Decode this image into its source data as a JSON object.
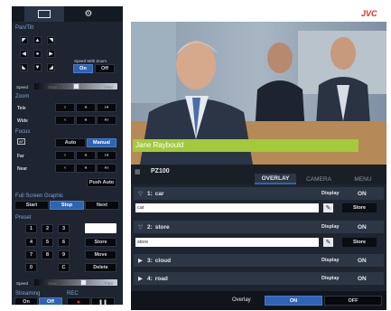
{
  "left": {
    "tabs": [
      {
        "icon": "monitor-icon"
      },
      {
        "icon": "gear-icon"
      }
    ],
    "pan_tilt": {
      "title": "Pan/Tilt",
      "speed_with_zoom_label": "Speed With Zoom",
      "on": "On",
      "off": "Off",
      "speed_label": "Speed",
      "slow": "Slow",
      "fast": "Fast",
      "speed_level": 0.5
    },
    "zoom": {
      "title": "Zoom",
      "tele": "Tele",
      "wide": "Wide"
    },
    "focus": {
      "title": "Focus",
      "af_icon": "AF",
      "auto": "Auto",
      "manual": "Manual",
      "far": "Far",
      "near": "Near",
      "push_auto": "Push Auto"
    },
    "full_screen_graphic": {
      "title": "Full Screen Graphic",
      "start": "Start",
      "stop": "Stop",
      "next": "Next"
    },
    "preset": {
      "title": "Preset",
      "keys": [
        "1",
        "2",
        "3",
        "4",
        "5",
        "6",
        "7",
        "8",
        "9",
        "0",
        "C"
      ],
      "store": "Store",
      "move": "Move",
      "delete": "Delete",
      "speed_label": "Speed",
      "slow": "Slow",
      "fast": "Fast",
      "speed_level": 0.6
    },
    "streaming": {
      "title": "Streaming",
      "on": "On",
      "off": "Off"
    },
    "rec": {
      "title": "REC"
    }
  },
  "brand": "JVC",
  "video": {
    "lower_third": "Jane Raybould"
  },
  "camera_bar": {
    "camera_name": "PZ100",
    "tabs": [
      "OVERLAY",
      "CAMERA",
      "MENU"
    ],
    "active_tab": "OVERLAY"
  },
  "overlays": [
    {
      "num": "1:",
      "name": "car",
      "display_label": "Display",
      "display": "ON",
      "expanded": true,
      "input_value": "car",
      "store": "Store"
    },
    {
      "num": "2:",
      "name": "store",
      "display_label": "Display",
      "display": "ON",
      "expanded": true,
      "input_value": "store",
      "store": "Store"
    },
    {
      "num": "3:",
      "name": "cloud",
      "display_label": "Display",
      "display": "ON",
      "expanded": false
    },
    {
      "num": "4:",
      "name": "road",
      "display_label": "Display",
      "display": "ON",
      "expanded": false
    }
  ],
  "overlay_toggle": {
    "label": "Overlay",
    "on": "ON",
    "off": "OFF"
  },
  "colors": {
    "accent_blue": "#2f63b3",
    "lower_third_green": "#a4c93a",
    "brand_red": "#e32b2b",
    "panel": "#1e2530"
  }
}
